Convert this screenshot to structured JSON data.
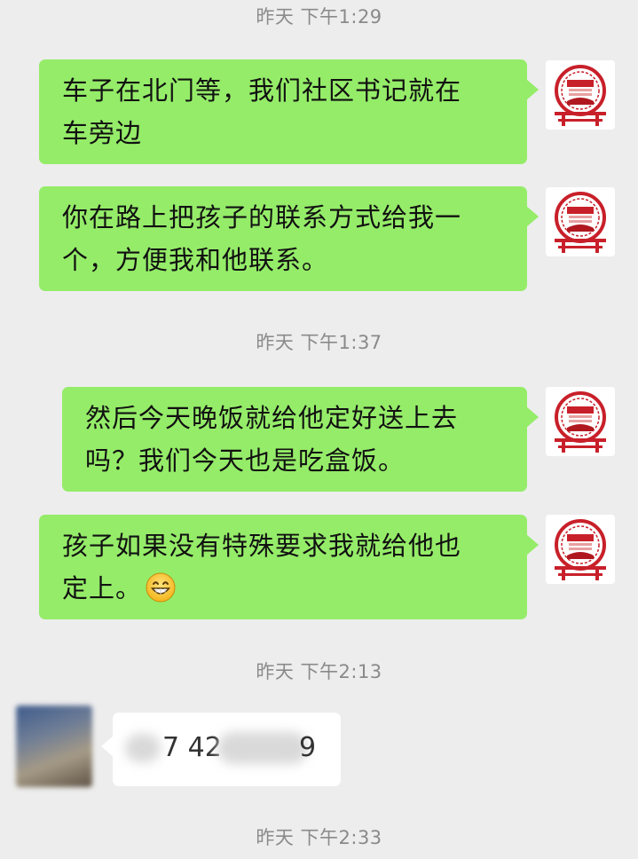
{
  "chat": {
    "timestamps": [
      "昨天 下午1:29",
      "昨天 下午1:37",
      "昨天 下午2:13",
      "昨天 下午2:33"
    ],
    "outgoing": [
      {
        "line1": "车子在北门等，我们社区书记就在",
        "line2": "车旁边"
      },
      {
        "line1": "你在路上把孩子的联系方式给我一",
        "line2": "个，方便我和他联系。"
      },
      {
        "line1": "然后今天晚饭就给他定好送上去",
        "line2": "吗？我们今天也是吃盒饭。"
      },
      {
        "line1": "孩子如果没有特殊要求我就给他也",
        "line2": "定上。",
        "emoji": "grinning-face-icon"
      }
    ],
    "incoming": {
      "visible_text_1": "7 42",
      "visible_text_2": "9"
    }
  },
  "colors": {
    "background": "#ededed",
    "outgoing_bubble": "#95ec69",
    "incoming_bubble": "#ffffff",
    "timestamp_text": "#8a8a8a",
    "avatar_red": "#c8202a"
  }
}
